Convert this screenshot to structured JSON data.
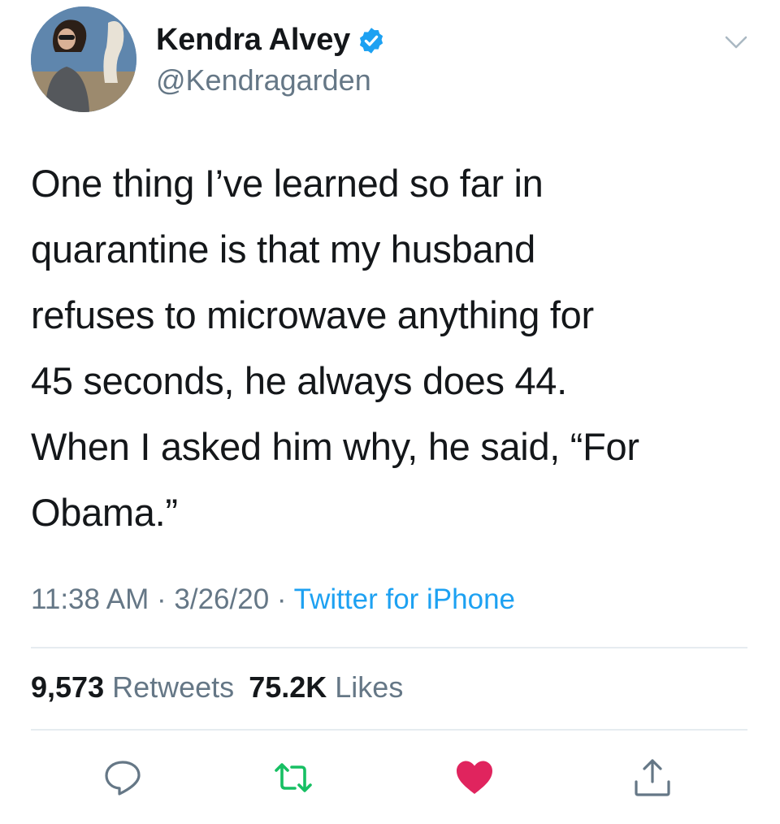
{
  "user": {
    "display_name": "Kendra Alvey",
    "handle": "@Kendragarden",
    "verified": true
  },
  "tweet": {
    "text": "One thing I’ve learned so far in\nquarantine is that my husband\nrefuses to microwave anything for\n45 seconds, he always does 44.\nWhen I asked him why, he said, “For\nObama.”",
    "time": "11:38 AM",
    "separator": "·",
    "date": "3/26/20",
    "source": "Twitter for iPhone"
  },
  "stats": {
    "retweets_count": "9,573",
    "retweets_label": "Retweets",
    "likes_count": "75.2K",
    "likes_label": "Likes"
  },
  "actions": [
    {
      "icon": "reply-icon"
    },
    {
      "icon": "retweet-icon",
      "color": "#17bf63"
    },
    {
      "icon": "like-heart-icon",
      "color": "#e0245e",
      "state": "liked"
    },
    {
      "icon": "share-icon"
    }
  ],
  "colors": {
    "link": "#1da1f2",
    "secondary_text": "#657786",
    "verified": "#1da1f2",
    "retweet": "#17bf63",
    "like": "#e0245e"
  }
}
